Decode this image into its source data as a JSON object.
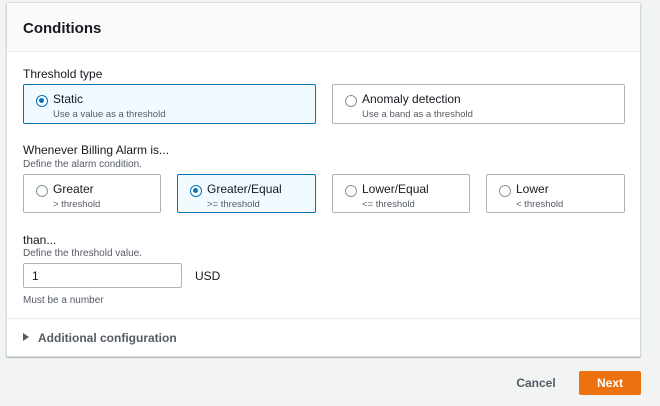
{
  "panel": {
    "title": "Conditions"
  },
  "threshold_type": {
    "label": "Threshold type",
    "options": [
      {
        "title": "Static",
        "description": "Use a value as a threshold",
        "selected": true
      },
      {
        "title": "Anomaly detection",
        "description": "Use a band as a threshold",
        "selected": false
      }
    ]
  },
  "whenever": {
    "label": "Whenever Billing Alarm is...",
    "description": "Define the alarm condition.",
    "options": [
      {
        "title": "Greater",
        "description": "> threshold",
        "selected": false
      },
      {
        "title": "Greater/Equal",
        "description": ">= threshold",
        "selected": true
      },
      {
        "title": "Lower/Equal",
        "description": "<= threshold",
        "selected": false
      },
      {
        "title": "Lower",
        "description": "< threshold",
        "selected": false
      }
    ]
  },
  "than": {
    "label": "than...",
    "description": "Define the threshold value.",
    "value": "1",
    "unit": "USD",
    "hint": "Must be a number"
  },
  "additional": {
    "label": "Additional configuration"
  },
  "footer": {
    "cancel_label": "Cancel",
    "next_label": "Next"
  },
  "colors": {
    "accent": "#0073bb",
    "primary_button": "#ec7211"
  }
}
